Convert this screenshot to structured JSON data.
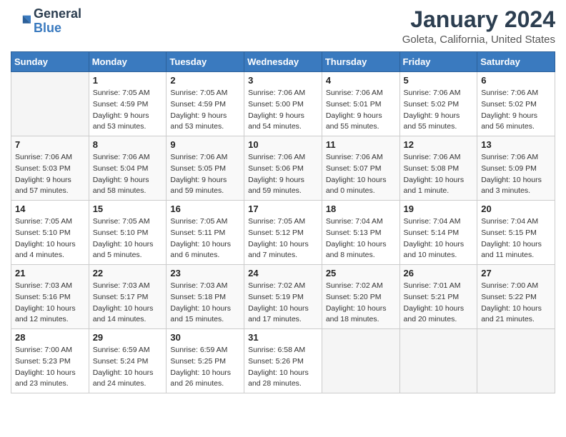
{
  "logo": {
    "text_general": "General",
    "text_blue": "Blue"
  },
  "title": "January 2024",
  "location": "Goleta, California, United States",
  "days_of_week": [
    "Sunday",
    "Monday",
    "Tuesday",
    "Wednesday",
    "Thursday",
    "Friday",
    "Saturday"
  ],
  "weeks": [
    [
      {
        "num": "",
        "empty": true
      },
      {
        "num": "1",
        "sunrise": "7:05 AM",
        "sunset": "4:59 PM",
        "daylight": "9 hours and 53 minutes."
      },
      {
        "num": "2",
        "sunrise": "7:05 AM",
        "sunset": "4:59 PM",
        "daylight": "9 hours and 53 minutes."
      },
      {
        "num": "3",
        "sunrise": "7:06 AM",
        "sunset": "5:00 PM",
        "daylight": "9 hours and 54 minutes."
      },
      {
        "num": "4",
        "sunrise": "7:06 AM",
        "sunset": "5:01 PM",
        "daylight": "9 hours and 55 minutes."
      },
      {
        "num": "5",
        "sunrise": "7:06 AM",
        "sunset": "5:02 PM",
        "daylight": "9 hours and 55 minutes."
      },
      {
        "num": "6",
        "sunrise": "7:06 AM",
        "sunset": "5:02 PM",
        "daylight": "9 hours and 56 minutes."
      }
    ],
    [
      {
        "num": "7",
        "sunrise": "7:06 AM",
        "sunset": "5:03 PM",
        "daylight": "9 hours and 57 minutes."
      },
      {
        "num": "8",
        "sunrise": "7:06 AM",
        "sunset": "5:04 PM",
        "daylight": "9 hours and 58 minutes."
      },
      {
        "num": "9",
        "sunrise": "7:06 AM",
        "sunset": "5:05 PM",
        "daylight": "9 hours and 59 minutes."
      },
      {
        "num": "10",
        "sunrise": "7:06 AM",
        "sunset": "5:06 PM",
        "daylight": "9 hours and 59 minutes."
      },
      {
        "num": "11",
        "sunrise": "7:06 AM",
        "sunset": "5:07 PM",
        "daylight": "10 hours and 0 minutes."
      },
      {
        "num": "12",
        "sunrise": "7:06 AM",
        "sunset": "5:08 PM",
        "daylight": "10 hours and 1 minute."
      },
      {
        "num": "13",
        "sunrise": "7:06 AM",
        "sunset": "5:09 PM",
        "daylight": "10 hours and 3 minutes."
      }
    ],
    [
      {
        "num": "14",
        "sunrise": "7:05 AM",
        "sunset": "5:10 PM",
        "daylight": "10 hours and 4 minutes."
      },
      {
        "num": "15",
        "sunrise": "7:05 AM",
        "sunset": "5:10 PM",
        "daylight": "10 hours and 5 minutes."
      },
      {
        "num": "16",
        "sunrise": "7:05 AM",
        "sunset": "5:11 PM",
        "daylight": "10 hours and 6 minutes."
      },
      {
        "num": "17",
        "sunrise": "7:05 AM",
        "sunset": "5:12 PM",
        "daylight": "10 hours and 7 minutes."
      },
      {
        "num": "18",
        "sunrise": "7:04 AM",
        "sunset": "5:13 PM",
        "daylight": "10 hours and 8 minutes."
      },
      {
        "num": "19",
        "sunrise": "7:04 AM",
        "sunset": "5:14 PM",
        "daylight": "10 hours and 10 minutes."
      },
      {
        "num": "20",
        "sunrise": "7:04 AM",
        "sunset": "5:15 PM",
        "daylight": "10 hours and 11 minutes."
      }
    ],
    [
      {
        "num": "21",
        "sunrise": "7:03 AM",
        "sunset": "5:16 PM",
        "daylight": "10 hours and 12 minutes."
      },
      {
        "num": "22",
        "sunrise": "7:03 AM",
        "sunset": "5:17 PM",
        "daylight": "10 hours and 14 minutes."
      },
      {
        "num": "23",
        "sunrise": "7:03 AM",
        "sunset": "5:18 PM",
        "daylight": "10 hours and 15 minutes."
      },
      {
        "num": "24",
        "sunrise": "7:02 AM",
        "sunset": "5:19 PM",
        "daylight": "10 hours and 17 minutes."
      },
      {
        "num": "25",
        "sunrise": "7:02 AM",
        "sunset": "5:20 PM",
        "daylight": "10 hours and 18 minutes."
      },
      {
        "num": "26",
        "sunrise": "7:01 AM",
        "sunset": "5:21 PM",
        "daylight": "10 hours and 20 minutes."
      },
      {
        "num": "27",
        "sunrise": "7:00 AM",
        "sunset": "5:22 PM",
        "daylight": "10 hours and 21 minutes."
      }
    ],
    [
      {
        "num": "28",
        "sunrise": "7:00 AM",
        "sunset": "5:23 PM",
        "daylight": "10 hours and 23 minutes."
      },
      {
        "num": "29",
        "sunrise": "6:59 AM",
        "sunset": "5:24 PM",
        "daylight": "10 hours and 24 minutes."
      },
      {
        "num": "30",
        "sunrise": "6:59 AM",
        "sunset": "5:25 PM",
        "daylight": "10 hours and 26 minutes."
      },
      {
        "num": "31",
        "sunrise": "6:58 AM",
        "sunset": "5:26 PM",
        "daylight": "10 hours and 28 minutes."
      },
      {
        "num": "",
        "empty": true
      },
      {
        "num": "",
        "empty": true
      },
      {
        "num": "",
        "empty": true
      }
    ]
  ],
  "labels": {
    "sunrise": "Sunrise:",
    "sunset": "Sunset:",
    "daylight": "Daylight:"
  }
}
